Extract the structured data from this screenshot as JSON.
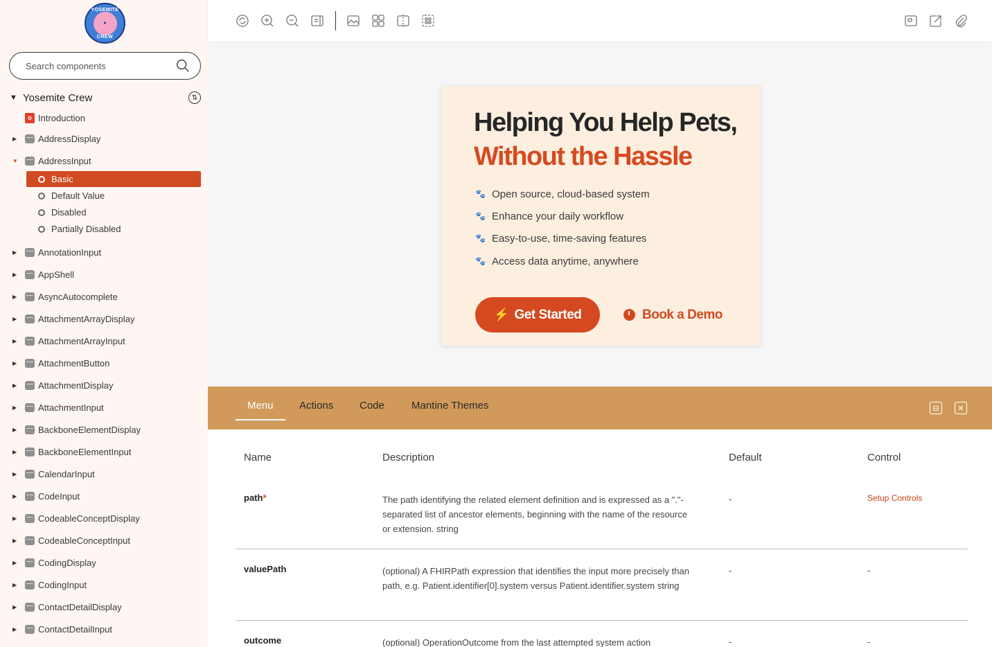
{
  "brand": {
    "ring_top": "YOSEMITE",
    "ring_bottom": "CREW"
  },
  "search": {
    "placeholder": "Search components"
  },
  "tree": {
    "root_label": "Yosemite Crew",
    "intro": "Introduction",
    "items_top": [
      "AddressDisplay"
    ],
    "expanded": "AddressInput",
    "stories": [
      "Basic",
      "Default Value",
      "Disabled",
      "Partially Disabled"
    ],
    "active_story": "Basic",
    "items": [
      "AnnotationInput",
      "AppShell",
      "AsyncAutocomplete",
      "AttachmentArrayDisplay",
      "AttachmentArrayInput",
      "AttachmentButton",
      "AttachmentDisplay",
      "AttachmentInput",
      "BackboneElementDisplay",
      "BackboneElementInput",
      "CalendarInput",
      "CodeInput",
      "CodeableConceptDisplay",
      "CodeableConceptInput",
      "CodingDisplay",
      "CodingInput",
      "ContactDetailDisplay",
      "ContactDetailInput"
    ]
  },
  "toolbar": {
    "left_icons": [
      "reload-icon",
      "zoom-in-icon",
      "zoom-out-icon",
      "reset-zoom-icon",
      "background-icon",
      "grid-icon",
      "viewport-icon",
      "measure-icon"
    ],
    "right_icons": [
      "fullscreen-icon",
      "open-new-tab-icon",
      "copy-link-icon"
    ]
  },
  "preview": {
    "headline_line1": "Helping You Help Pets,",
    "headline_line2": "Without the Hassle",
    "bullets": [
      {
        "text": "Open source, cloud-based system",
        "color": "#d4491f"
      },
      {
        "text": "Enhance your daily workflow",
        "color": "#f2a94e"
      },
      {
        "text": "Easy-to-use, time-saving features",
        "color": "#7b6fd6"
      },
      {
        "text": "Access data anytime, anywhere",
        "color": "#5fb8a3"
      }
    ],
    "primary_button": "Get Started",
    "secondary_button": "Book a Demo",
    "accent_color": "#d4491f"
  },
  "panel": {
    "tabs": [
      "Menu",
      "Actions",
      "Code",
      "Mantine Themes"
    ],
    "active_tab": "Menu",
    "columns": [
      "Name",
      "Description",
      "Default",
      "Control"
    ],
    "rows": [
      {
        "name": "path",
        "required": "*",
        "desc": "The path identifying the related element definition and is expressed as a \".\"-separated list of ancestor elements, beginning with the name of the resource or extension. string",
        "default": "-",
        "control": "Setup Controls"
      },
      {
        "name": "valuePath",
        "desc": "(optional) A FHIRPath expression that identifies the input more precisely than path, e.g. Patient.identifier[0].system versus Patient.identifier.system string",
        "default": "-",
        "control": "-"
      },
      {
        "name": "outcome",
        "desc": "(optional) OperationOutcome from the last attempted system action",
        "default": "-",
        "control": "-"
      }
    ]
  }
}
